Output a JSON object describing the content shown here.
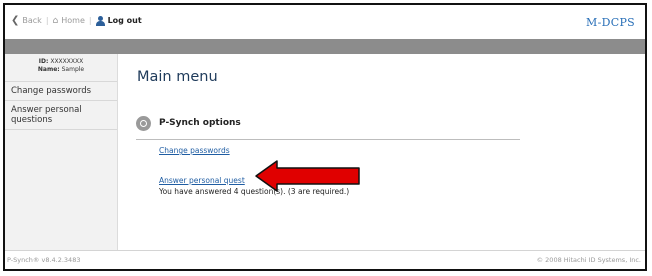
{
  "nav": {
    "back_label": "Back",
    "home_label": "Home",
    "logout_label": "Log out"
  },
  "brand": "M-DCPS",
  "user": {
    "id_label": "ID:",
    "id_value": "XXXXXXXX",
    "name_label": "Name:",
    "name_value": "Sample"
  },
  "sidebar": {
    "items": [
      {
        "label": "Change passwords"
      },
      {
        "label": "Answer personal questions"
      }
    ]
  },
  "main": {
    "title": "Main menu",
    "section_title": "P-Synch options",
    "change_link": "Change passwords",
    "answer_link": "Answer personal quest",
    "answer_note": "You have answered 4 question(s). (3 are required.)"
  },
  "footer": {
    "version": "P-Synch® v8.4.2.3483",
    "copyright": "© 2008 Hitachi ID Systems, Inc."
  },
  "colors": {
    "brand": "#2a70b8",
    "link": "#1f5da3",
    "arrow": "#e00000",
    "band": "#8c8c8c"
  },
  "icons": [
    "back-chevron-icon",
    "home-icon",
    "user-icon",
    "psynch-options-icon",
    "red-arrow-icon"
  ]
}
